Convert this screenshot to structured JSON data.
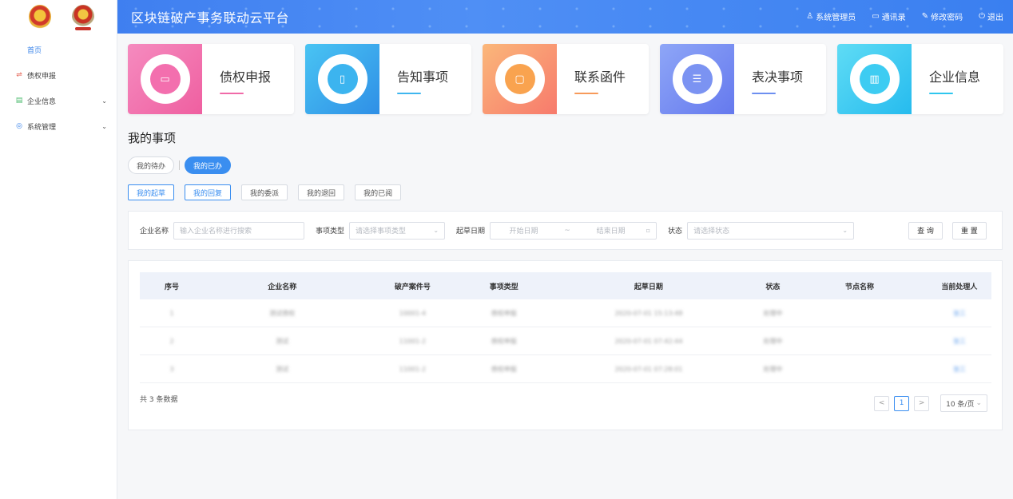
{
  "header": {
    "title": "区块链破产事务联动云平台",
    "actions": [
      {
        "icon": "user-icon",
        "label": "系统管理员"
      },
      {
        "icon": "contacts-icon",
        "label": "通讯录"
      },
      {
        "icon": "edit-icon",
        "label": "修改密码"
      },
      {
        "icon": "power-icon",
        "label": "退出"
      }
    ]
  },
  "sidebar": {
    "items": [
      {
        "label": "首页",
        "active": true
      },
      {
        "label": "债权申报",
        "icon": "exchange-icon"
      },
      {
        "label": "企业信息",
        "icon": "document-icon",
        "expandable": true
      },
      {
        "label": "系统管理",
        "icon": "settings-icon",
        "expandable": true
      }
    ]
  },
  "cards": [
    {
      "label": "债权申报",
      "color": "#f06aa8"
    },
    {
      "label": "告知事项",
      "color": "#3fb6ef"
    },
    {
      "label": "联系函件",
      "color": "#f79a5a"
    },
    {
      "label": "表决事项",
      "color": "#6d8ff0"
    },
    {
      "label": "企业信息",
      "color": "#2fc6ee"
    }
  ],
  "section": {
    "title": "我的事项"
  },
  "tabs_primary": [
    "我的待办",
    "我的已办"
  ],
  "tabs_secondary": [
    "我的起草",
    "我的回复",
    "我的委派",
    "我的退回",
    "我的已阅"
  ],
  "filter": {
    "company_label": "企业名称",
    "company_placeholder": "输入企业名称进行搜索",
    "type_label": "事项类型",
    "type_placeholder": "请选择事项类型",
    "date_label": "起草日期",
    "date_start": "开始日期",
    "date_sep": "~",
    "date_end": "结束日期",
    "status_label": "状态",
    "status_placeholder": "请选择状态",
    "query": "查 询",
    "reset": "重 置"
  },
  "table": {
    "columns": [
      "序号",
      "企业名称",
      "破产案件号",
      "事项类型",
      "起草日期",
      "状态",
      "节点名称",
      "当前处理人"
    ],
    "rows": [
      [
        "1",
        "测试债权",
        "10001-4",
        "债权申报",
        "2020-07-01 15:13:48",
        "处理中",
        "",
        "张三"
      ],
      [
        "2",
        "测试",
        "11001-2",
        "债权申报",
        "2020-07-01 07:42:44",
        "处理中",
        "",
        "张三"
      ],
      [
        "3",
        "测试",
        "11001-2",
        "债权申报",
        "2020-07-01 07:28:01",
        "处理中",
        "",
        "张三"
      ]
    ]
  },
  "pagination": {
    "total": "共 3 条数据",
    "prev": "<",
    "page": "1",
    "next": ">",
    "size": "10 条/页"
  }
}
